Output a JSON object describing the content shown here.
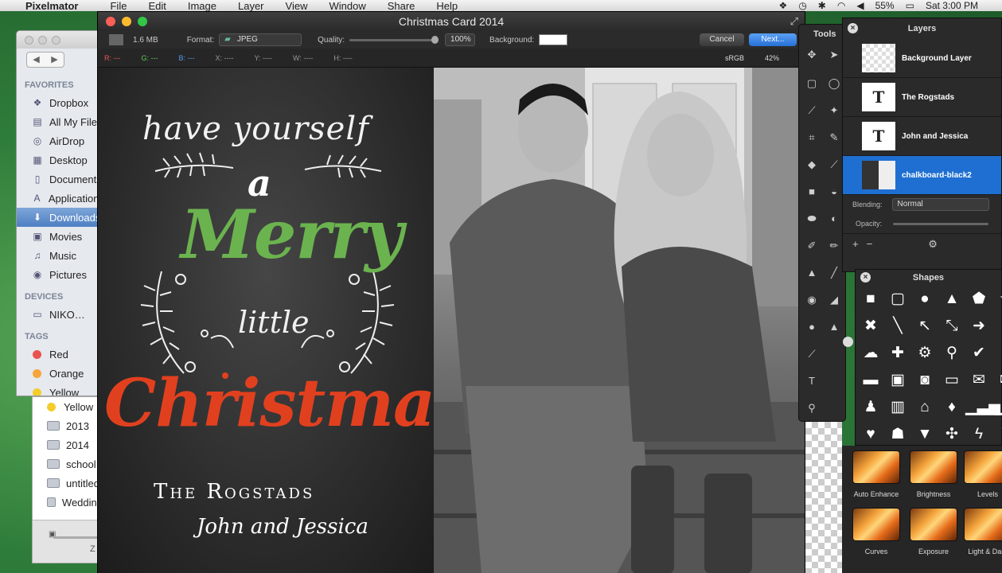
{
  "menubar": {
    "app": "Pixelmator",
    "items": [
      "File",
      "Edit",
      "Image",
      "Layer",
      "View",
      "Window",
      "Share",
      "Help"
    ],
    "battery": "55%",
    "clock": "Sat 3:00 PM"
  },
  "finder": {
    "favorites_header": "FAVORITES",
    "favorites": [
      {
        "label": "Dropbox",
        "icon": "dropbox-icon"
      },
      {
        "label": "All My Files",
        "icon": "files-icon"
      },
      {
        "label": "AirDrop",
        "icon": "airdrop-icon"
      },
      {
        "label": "Desktop",
        "icon": "desktop-icon"
      },
      {
        "label": "Documents",
        "icon": "document-icon"
      },
      {
        "label": "Applications",
        "icon": "applications-icon"
      },
      {
        "label": "Downloads",
        "icon": "download-icon"
      },
      {
        "label": "Movies",
        "icon": "movies-icon"
      },
      {
        "label": "Music",
        "icon": "music-icon"
      },
      {
        "label": "Pictures",
        "icon": "pictures-icon"
      }
    ],
    "devices_header": "DEVICES",
    "devices": [
      {
        "label": "NIKO…",
        "icon": "disk-icon"
      }
    ],
    "tags_header": "TAGS",
    "tags": [
      {
        "label": "Red",
        "color": "#e9534e"
      },
      {
        "label": "Orange",
        "color": "#f6a53a"
      },
      {
        "label": "Yellow",
        "color": "#f5cd2a"
      }
    ],
    "list": [
      "Yellow",
      "2013",
      "2014",
      "school",
      "untitled",
      "Wedding"
    ],
    "footer_label": "Z"
  },
  "window": {
    "title": "Christmas Card 2014",
    "file_size": "1.6 MB",
    "format_label": "Format:",
    "format_value": "JPEG",
    "quality_label": "Quality:",
    "quality_value": "100%",
    "background_label": "Background:",
    "cancel": "Cancel",
    "next": "Next...",
    "info": {
      "r": "R: ---",
      "g": "G: ---",
      "b": "B: ---",
      "x": "X: ----",
      "y": "Y: ----",
      "w": "W: ----",
      "h": "H: ----"
    },
    "colorspace": "sRGB",
    "zoom": "42%"
  },
  "card": {
    "line1": "have yourself",
    "line2": "a",
    "line3": "Merry",
    "line4": "little",
    "line5": "Christmas",
    "line6": "The Rogstads",
    "line7": "John and Jessica"
  },
  "tools": {
    "title": "Tools"
  },
  "layers": {
    "title": "Layers",
    "items": [
      {
        "name": "Background Layer",
        "thumb": ""
      },
      {
        "name": "The Rogstads",
        "thumb": "T"
      },
      {
        "name": "John and Jessica",
        "thumb": "T"
      },
      {
        "name": "chalkboard-black2",
        "thumb": ""
      }
    ],
    "blending_label": "Blending:",
    "blending_value": "Normal",
    "opacity_label": "Opacity:"
  },
  "shapes": {
    "title": "Shapes",
    "icons": [
      "square-icon",
      "rounded-square-icon",
      "circle-icon",
      "triangle-icon",
      "pentagon-icon",
      "star-icon",
      "x-mark-icon",
      "line-icon",
      "arrow-diagonal-icon",
      "double-arrow-icon",
      "arrow-right-icon",
      "circle-icon",
      "cloud-icon",
      "plus-icon",
      "gear-icon",
      "magnifier-icon",
      "check-icon",
      "lock-icon",
      "folder-icon",
      "image-icon",
      "camera-icon",
      "monitor-icon",
      "mail-icon",
      "mail-icon",
      "person-icon",
      "building-icon",
      "home-icon",
      "pin-icon",
      "signal-icon",
      "signal-icon",
      "heart-icon",
      "ghost-icon",
      "drop-icon",
      "butterfly-icon",
      "lightning-icon",
      "flag-icon"
    ]
  },
  "effects": {
    "items": [
      "Auto Enhance",
      "Brightness",
      "Levels",
      "Curves",
      "Exposure",
      "Light & Dark"
    ]
  }
}
